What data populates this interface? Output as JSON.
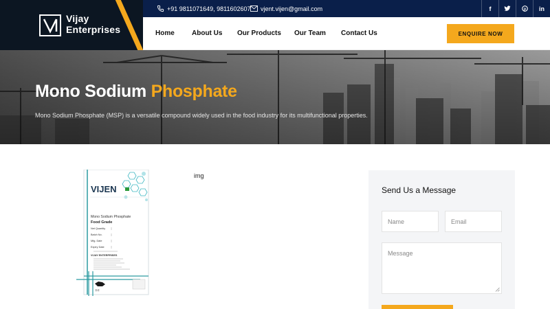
{
  "brand": {
    "line1": "Vijay",
    "line2": "Enterprises"
  },
  "topbar": {
    "phone": "+91 9811071649,  9811602607",
    "email": "vjent.vijen@gmail.com",
    "socials": [
      {
        "icon": "facebook-icon",
        "glyph": "f"
      },
      {
        "icon": "twitter-icon",
        "glyph": "🐦"
      },
      {
        "icon": "pinterest-icon",
        "glyph": "⓿"
      },
      {
        "icon": "linkedin-icon",
        "glyph": "in"
      }
    ]
  },
  "nav": {
    "items": [
      "Home",
      "About Us",
      "Our Products",
      "Our Team",
      "Contact Us"
    ],
    "cta": "ENQUIRE NOW"
  },
  "hero": {
    "title_plain": "Mono Sodium ",
    "title_accent": "Phosphate",
    "subtitle": "Mono Sodium Phosphate (MSP) is a versatile compound widely used in the food industry for its multifunctional properties."
  },
  "product": {
    "alt_text": "img",
    "bag": {
      "brand": "VIJEN",
      "name": "Mono Sodium Phosphate",
      "grade": "Food Grade",
      "fields": [
        "Net Quantity",
        "Batch No.",
        "Mfg. Date",
        "Expiry Date"
      ],
      "maker": "VIJAY ENTERPRISES"
    }
  },
  "form": {
    "title": "Send Us a Message",
    "name_placeholder": "Name",
    "email_placeholder": "Email",
    "message_placeholder": "Message"
  },
  "colors": {
    "accent": "#f4a81d",
    "topbar": "#0a1f4a",
    "logo_bg": "#0c1622"
  }
}
